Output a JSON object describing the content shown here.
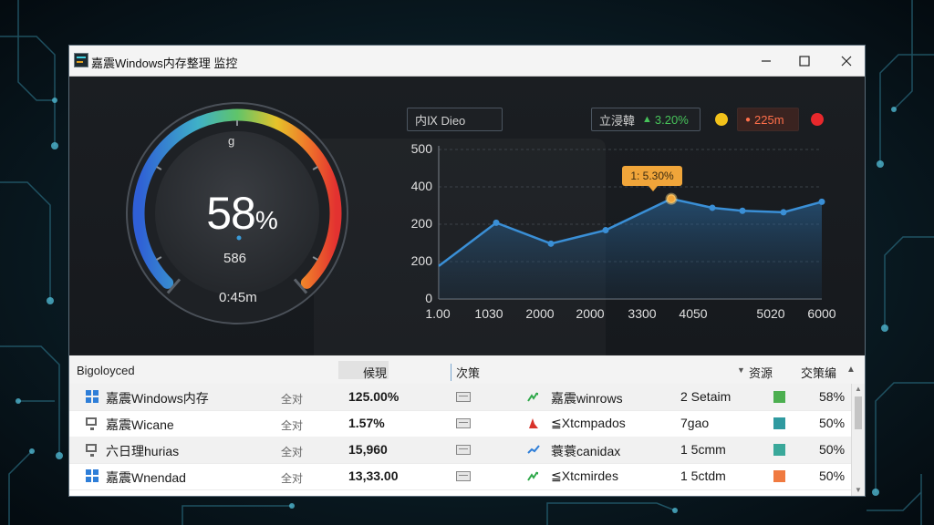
{
  "window": {
    "title": "嘉震Windows内存整理 监控",
    "controls": [
      "minimize",
      "maximize",
      "close"
    ]
  },
  "gauge": {
    "percent": 58,
    "percent_text": "58",
    "percent_unit": "%",
    "top_label": "g",
    "value_label": "586",
    "time_label": "0:45m"
  },
  "header_chips": {
    "title": "内Ⅸ Dieo",
    "stat_label": "立浸韓",
    "stat_value": "3.20%",
    "alert_value": "225m",
    "colors": {
      "green": "#47c35a",
      "yellow": "#f2c21a",
      "red": "#e8282c",
      "orange": "#ff6f4a"
    }
  },
  "tooltip": {
    "text": "1: 5.30%"
  },
  "chart_data": {
    "type": "area",
    "y_ticks": [
      "500",
      "400",
      "200",
      "200",
      "0"
    ],
    "x_ticks": [
      "1.00",
      "1030",
      "2000",
      "2000",
      "3300",
      "4050",
      "5020",
      "6000"
    ],
    "ylim": [
      0,
      500
    ],
    "xlim": [
      0,
      7
    ],
    "grid": true,
    "color": "#3a8fd6",
    "x": [
      0,
      1.05,
      2.05,
      3.05,
      4.25,
      5.0,
      5.55,
      6.3,
      7.0
    ],
    "values": [
      110,
      255,
      185,
      230,
      335,
      305,
      295,
      290,
      325
    ],
    "highlight_index": 4
  },
  "table": {
    "headers": {
      "name": "Bigoloyced",
      "col2": "候現",
      "col3": "次策",
      "col4": "资源",
      "col5": "交策编"
    },
    "rows": [
      {
        "icon": "windows-icon",
        "name": "嘉震Windows内存",
        "type": "全对",
        "value": "125.00%",
        "trend_icon": "green-arrows-icon",
        "desc": "嘉震winrows",
        "size": "2 Setaim",
        "swatch": "#4caf50",
        "pct": "58%"
      },
      {
        "icon": "monitor-icon",
        "name": "嘉震Wicane",
        "type": "全对",
        "value": "1.57%",
        "trend_icon": "red-flag-icon",
        "desc": "≦Xtcmpados",
        "size": "7gao",
        "swatch": "#2f9aa0",
        "pct": "50%"
      },
      {
        "icon": "monitor-icon",
        "name": "六日理hurias",
        "type": "全对",
        "value": "15,960",
        "trend_icon": "blue-trend-icon",
        "desc": "蓑蓑canidax",
        "size": "1 5cmm",
        "swatch": "#3aa89a",
        "pct": "50%"
      },
      {
        "icon": "windows-icon",
        "name": "嘉震Wnendad",
        "type": "全对",
        "value": "13,33.00",
        "trend_icon": "green-arrows-icon",
        "desc": "≦Xtcmirdes",
        "size": "1 5ctdm",
        "swatch": "#f07a40",
        "pct": "50%"
      }
    ]
  }
}
